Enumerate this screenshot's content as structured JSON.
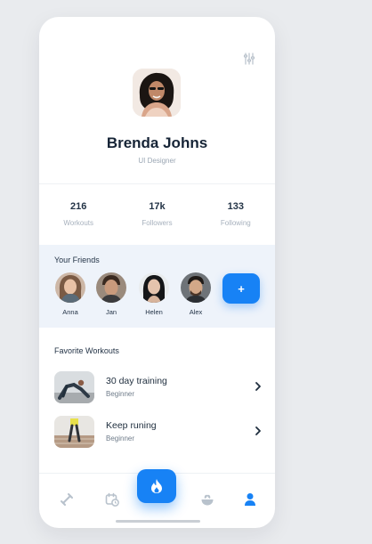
{
  "profile": {
    "name": "Brenda Johns",
    "role": "UI Designer"
  },
  "stats": [
    {
      "value": "216",
      "label": "Workouts"
    },
    {
      "value": "17k",
      "label": "Followers"
    },
    {
      "value": "133",
      "label": "Following"
    }
  ],
  "friends": {
    "title": "Your Friends",
    "items": [
      {
        "name": "Anna"
      },
      {
        "name": "Jan"
      },
      {
        "name": "Helen"
      },
      {
        "name": "Alex"
      }
    ],
    "add_label": "+"
  },
  "favorites": {
    "title": "Favorite Workouts",
    "items": [
      {
        "title": "30 day training",
        "level": "Beginner"
      },
      {
        "title": "Keep runing",
        "level": "Beginner"
      }
    ]
  },
  "tabbar": {
    "icons": [
      "dumbbell-icon",
      "calendar-clock-icon",
      "flame-icon",
      "bowl-icon",
      "profile-icon"
    ],
    "active": "profile-icon"
  },
  "colors": {
    "accent": "#1782f5",
    "friends_bg": "#eef3fa",
    "text_dark": "#162436",
    "text_muted": "#9aa6b3"
  }
}
